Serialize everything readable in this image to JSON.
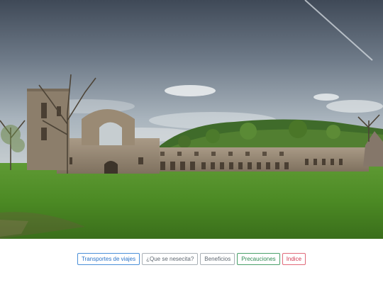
{
  "hero": {
    "sky_top": "#4a5564",
    "sky_mid": "#8d99a5",
    "grass": "#4e8a2a"
  },
  "nav": {
    "buttons": [
      {
        "label": "Transportes de viajes",
        "style": "blue"
      },
      {
        "label": "¿Que se nesecita?",
        "style": "gray"
      },
      {
        "label": "Beneficios",
        "style": "gray"
      },
      {
        "label": "Precauciones",
        "style": "green"
      },
      {
        "label": "Indice",
        "style": "red"
      }
    ]
  }
}
